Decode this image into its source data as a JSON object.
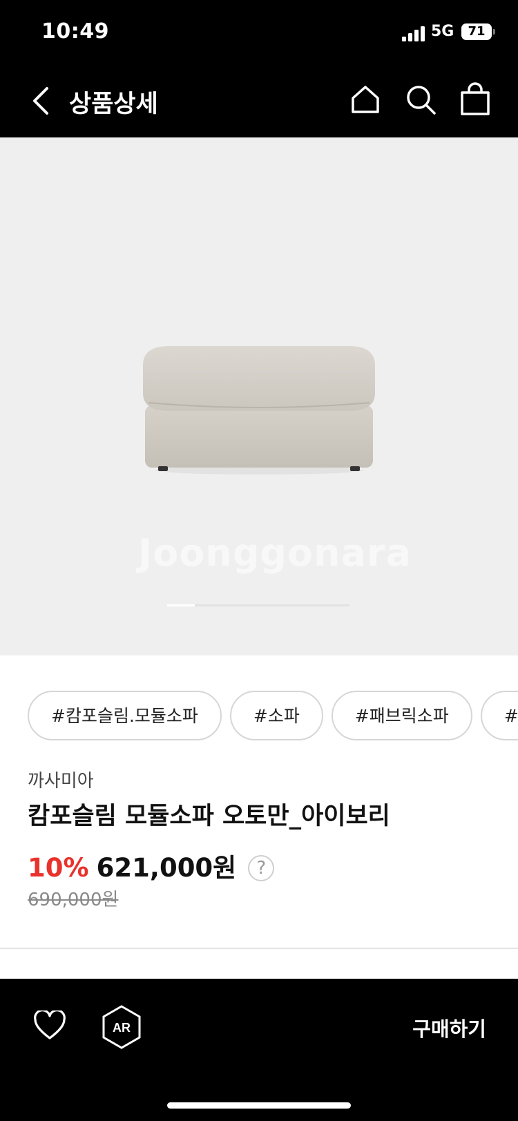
{
  "status_bar": {
    "time": "10:49",
    "network": "5G",
    "battery": "71"
  },
  "header": {
    "title": "상품상세",
    "icons": [
      "back-chevron-icon",
      "home-icon",
      "search-icon",
      "shopping-bag-icon"
    ]
  },
  "gallery": {
    "watermark": "Joonggonara",
    "current_image_fraction": 0.15
  },
  "tags": [
    "#캄포슬림.모듈소파",
    "#소파",
    "#패브릭소파",
    "#캄"
  ],
  "product": {
    "brand": "까사미아",
    "name": "캄포슬림 모듈소파 오토만_아이보리",
    "discount": "10%",
    "price": "621,000원",
    "help_label": "?",
    "original_price": "690,000원"
  },
  "bottom_bar": {
    "buy_label": "구매하기",
    "ar_label": "AR",
    "icons": [
      "heart-icon",
      "ar-icon"
    ]
  },
  "colors": {
    "bar_bg": "#000000",
    "discount_red": "#e8322b",
    "gallery_bg": "#efefef"
  }
}
